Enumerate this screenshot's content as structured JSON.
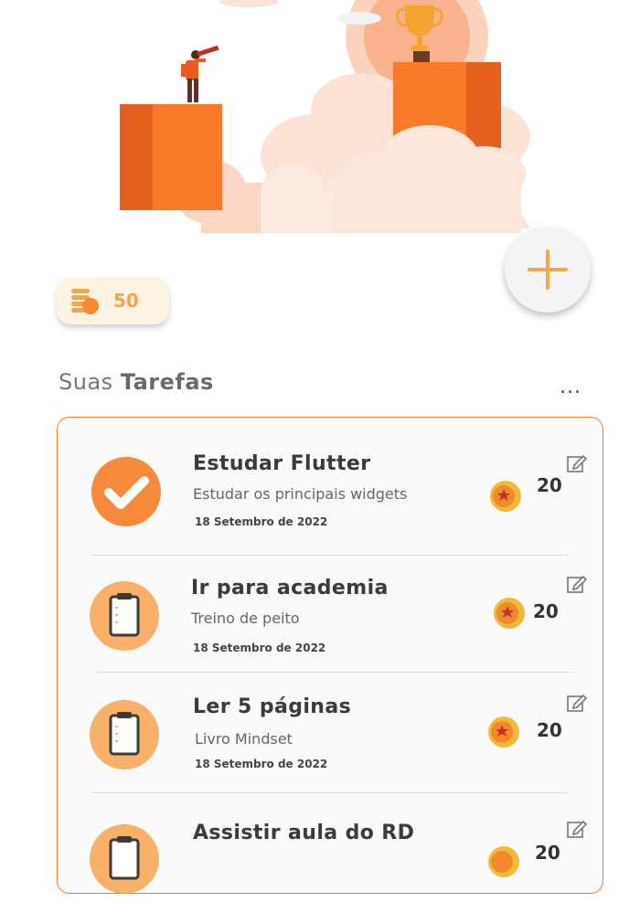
{
  "coins": {
    "value": "50",
    "icon": "coins-icon"
  },
  "fab": {
    "icon": "plus-icon"
  },
  "section": {
    "title_prefix": "Suas",
    "title_bold": "Tarefas",
    "more": "..."
  },
  "tasks": [
    {
      "title": "Estudar Flutter",
      "description": "Estudar os principais widgets",
      "date": "18 Setembro de 2022",
      "reward": "20",
      "status": "done",
      "icon": "check-icon"
    },
    {
      "title": "Ir para academia",
      "description": "Treino de peito",
      "date": "18 Setembro de 2022",
      "reward": "20",
      "status": "pending",
      "icon": "clipboard-icon"
    },
    {
      "title": "Ler 5 páginas",
      "description": "Livro Mindset",
      "date": "18 Setembro de 2022",
      "reward": "20",
      "status": "pending",
      "icon": "clipboard-icon"
    },
    {
      "title": "Assistir aula do RD",
      "description": "",
      "date": "",
      "reward": "20",
      "status": "pending",
      "icon": "clipboard-icon"
    }
  ],
  "colors": {
    "accent": "#f07a2d",
    "accent_light": "#f5a54a",
    "card_border": "#f07a2d"
  }
}
